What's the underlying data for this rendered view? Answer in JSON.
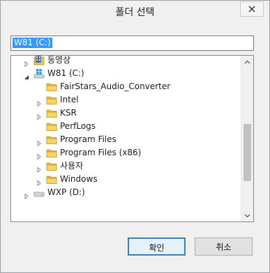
{
  "window": {
    "title": "폴더 선택"
  },
  "path_field": {
    "value": "W81 (C:)"
  },
  "tree": {
    "items": [
      {
        "label": "동영상",
        "icon": "video-library-icon",
        "expand": "collapsed"
      },
      {
        "label": "W81 (C:)",
        "icon": "windows-drive-icon",
        "expand": "expanded"
      },
      {
        "label": "FairStars_Audio_Converter",
        "icon": "folder-icon",
        "expand": "none"
      },
      {
        "label": "Intel",
        "icon": "folder-icon",
        "expand": "collapsed"
      },
      {
        "label": "KSR",
        "icon": "folder-icon",
        "expand": "collapsed"
      },
      {
        "label": "PerfLogs",
        "icon": "folder-icon",
        "expand": "none"
      },
      {
        "label": "Program Files",
        "icon": "folder-icon",
        "expand": "collapsed"
      },
      {
        "label": "Program Files (x86)",
        "icon": "folder-icon",
        "expand": "collapsed"
      },
      {
        "label": "사용자",
        "icon": "folder-icon",
        "expand": "collapsed"
      },
      {
        "label": "Windows",
        "icon": "folder-icon",
        "expand": "collapsed"
      },
      {
        "label": "WXP (D:)",
        "icon": "drive-icon",
        "expand": "collapsed"
      }
    ]
  },
  "buttons": {
    "ok_label": "확인",
    "cancel_label": "취소"
  },
  "colors": {
    "selection": "#3399ff",
    "default_button_border": "#3c7fb1",
    "folder": "#e8b93f"
  }
}
